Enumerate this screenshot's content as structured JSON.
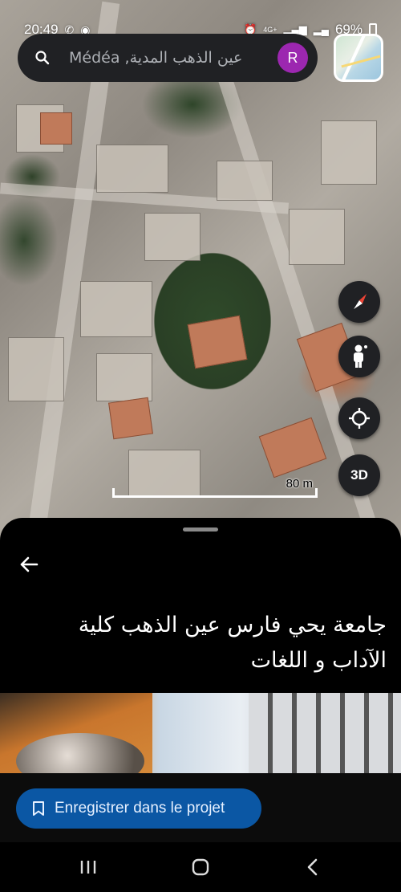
{
  "status_bar": {
    "time": "20:49",
    "battery": "69%",
    "network": "4G+"
  },
  "search": {
    "query": "Médéa ,عين الذهب المدية",
    "avatar_letter": "R"
  },
  "map": {
    "scale_label": "80 m",
    "control_3d_label": "3D"
  },
  "place": {
    "title": "جامعة يحي فارس عين الذهب كلية الآداب و اللغات"
  },
  "actions": {
    "save_label": "Enregistrer dans le projet"
  },
  "colors": {
    "save_button_bg": "#0b57a4",
    "avatar_bg": "#9c27b0",
    "search_bg": "#202124"
  }
}
